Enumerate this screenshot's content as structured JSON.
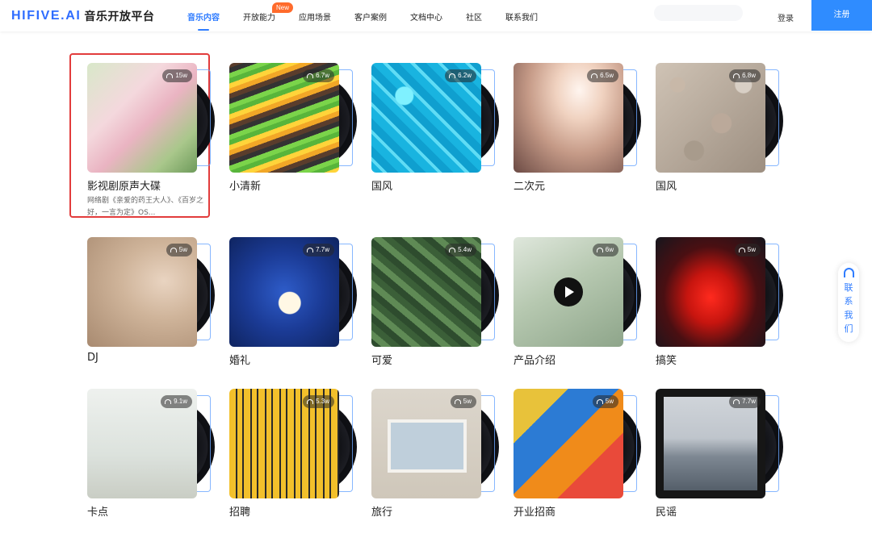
{
  "header": {
    "logo_mark": "HIFIVE.AI",
    "logo_text": "音乐开放平台",
    "nav": [
      {
        "label": "音乐内容",
        "active": true
      },
      {
        "label": "开放能力",
        "badge": "New"
      },
      {
        "label": "应用场景"
      },
      {
        "label": "客户案例"
      },
      {
        "label": "文档中心"
      },
      {
        "label": "社区"
      },
      {
        "label": "联系我们"
      }
    ],
    "login": "登录",
    "register": "注册"
  },
  "cards": [
    {
      "title": "影视剧原声大碟",
      "plays": "15w",
      "desc": "网络剧《亲爱的药王大人》、《百岁之好，一言为定》OS...",
      "selected": true
    },
    {
      "title": "小清新",
      "plays": "6.7w"
    },
    {
      "title": "国风",
      "plays": "6.2w"
    },
    {
      "title": "二次元",
      "plays": "6.5w"
    },
    {
      "title": "国风",
      "plays": "6.8w"
    },
    {
      "title": "DJ",
      "plays": "5w"
    },
    {
      "title": "婚礼",
      "plays": "7.7w"
    },
    {
      "title": "可爱",
      "plays": "5.4w"
    },
    {
      "title": "产品介绍",
      "plays": "6w",
      "playing_icon": true
    },
    {
      "title": "搞笑",
      "plays": "5w"
    },
    {
      "title": "卡点",
      "plays": "9.1w"
    },
    {
      "title": "招聘",
      "plays": "5.3w"
    },
    {
      "title": "旅行",
      "plays": "5w"
    },
    {
      "title": "开业招商",
      "plays": "5w"
    },
    {
      "title": "民谣",
      "plays": "7.7w"
    }
  ],
  "side_contact": {
    "label": "联系我们",
    "icon": "headset-icon"
  },
  "colors": {
    "accent": "#2f7cff",
    "register_bg": "#2f8cff",
    "new_badge": "#ff6b2c",
    "selection_outline": "#e23c3c"
  }
}
